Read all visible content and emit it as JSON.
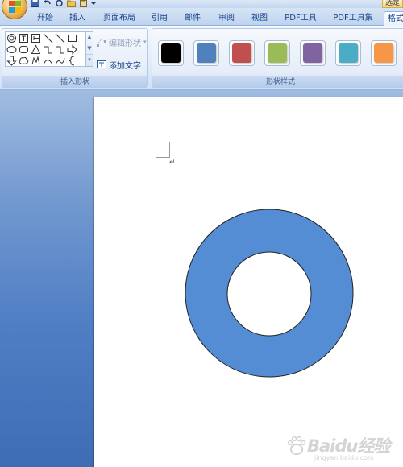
{
  "quick_access": {
    "icons": [
      "save-icon",
      "undo-icon",
      "redo-icon",
      "open-folder-icon",
      "clipboard-icon",
      "customize-dropdown-icon"
    ]
  },
  "context_tab_top": {
    "label": "选是"
  },
  "tabs": [
    {
      "label": "开始"
    },
    {
      "label": "插入"
    },
    {
      "label": "页面布局"
    },
    {
      "label": "引用"
    },
    {
      "label": "邮件"
    },
    {
      "label": "审阅"
    },
    {
      "label": "视图"
    },
    {
      "label": "PDF工具"
    },
    {
      "label": "PDF工具集"
    },
    {
      "label": "格式"
    }
  ],
  "ribbon": {
    "insert_shapes": {
      "label": "插入形状",
      "edit_shape": "编辑形状",
      "add_text": "添加文字"
    },
    "shape_styles": {
      "label": "形状样式",
      "swatches": [
        {
          "color": "#000000",
          "name": "black"
        },
        {
          "color": "#4f81bd",
          "name": "blue"
        },
        {
          "color": "#c0504d",
          "name": "red"
        },
        {
          "color": "#9bbb59",
          "name": "green"
        },
        {
          "color": "#8064a2",
          "name": "purple"
        },
        {
          "color": "#4bacc6",
          "name": "aqua"
        },
        {
          "color": "#f79646",
          "name": "orange"
        }
      ]
    }
  },
  "document": {
    "paragraph_mark": "↵",
    "shape": {
      "type": "donut",
      "fill": "#548dd4",
      "stroke": "#222222"
    }
  },
  "watermark": {
    "main": "Baidu经验",
    "sub": "jingyan.baidu.com"
  }
}
